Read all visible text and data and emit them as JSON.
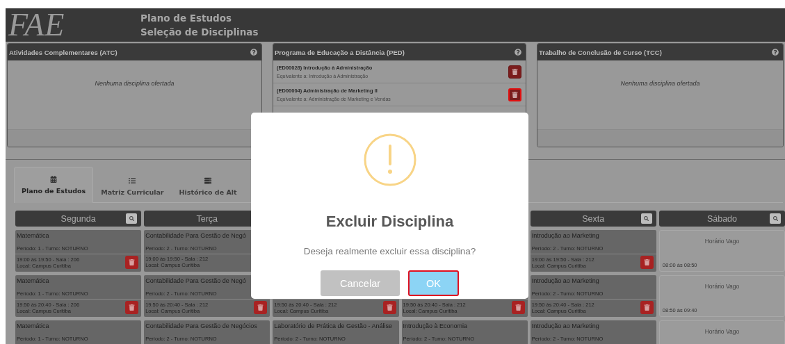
{
  "header": {
    "logo": "FAE",
    "title": "Plano de Estudos",
    "subtitle": "Seleção de Disciplinas"
  },
  "panels": [
    {
      "title": "Atividades Complementares (ATC)",
      "empty_text": "Nenhuma disciplina ofertada"
    },
    {
      "title": "Programa de Educação a Distância (PED)",
      "items": [
        {
          "title": "(ED00028) Introdução à Administração",
          "equivalent": "Equivalente a: Introdução à Administração",
          "focused": false
        },
        {
          "title": "(ED00004) Administração de Marketing II",
          "equivalent": "Equivalente a: Administração de Marketing e Vendas",
          "focused": true
        }
      ]
    },
    {
      "title": "Trabalho de Conclusão de Curso (TCC)",
      "empty_text": "Nenhuma disciplina ofertada"
    }
  ],
  "tabs": [
    {
      "label": "Plano de Estudos",
      "selected": true
    },
    {
      "label": "Matriz Curricular",
      "selected": false
    },
    {
      "label": "Histórico de Alt",
      "selected": false
    }
  ],
  "schedule": [
    {
      "day": "Segunda",
      "cells": [
        {
          "kind": "class",
          "title": "Matemática",
          "period": "Período: 1 - Turno: NOTURNO",
          "time": "19:00 às 19:50 - Sala : 206",
          "place": "Local: Campus Curitiba",
          "delete_button": true
        },
        {
          "kind": "class",
          "title": "Matemática",
          "period": "Período: 1 - Turno: NOTURNO",
          "time": "19:50 às 20:40 - Sala : 206",
          "place": "Local: Campus Curitiba",
          "delete_button": true
        },
        {
          "kind": "class",
          "title": "Matemática",
          "period": "Período: 1 - Turno: NOTURNO"
        }
      ]
    },
    {
      "day": "Terça",
      "cells": [
        {
          "kind": "class",
          "title": "Contabilidade Para Gestão de Negó",
          "period": "Período: 2 - Turno: NOTURNO",
          "time": "19:00 às 19:50 - Sala : 212",
          "place": "Local: Campus Curitiba",
          "delete_button": false
        },
        {
          "kind": "class",
          "title": "Contabilidade Para Gestão de Negó",
          "period": "Período: 2 - Turno: NOTURNO",
          "time": "19:50 às 20:40 - Sala : 212",
          "place": "Local: Campus Curitiba",
          "delete_button": true
        },
        {
          "kind": "class",
          "title": "Contabilidade Para Gestão de Negócios",
          "period": "Período: 2 - Turno: NOTURNO"
        }
      ]
    },
    {
      "cells": [
        {
          "kind": "covered"
        },
        {
          "kind": "class",
          "time": "19:50 às 20:40 - Sala : 212",
          "place": "Local: Campus Curitiba",
          "delete_button": true
        },
        {
          "kind": "class",
          "title": "Laboratório de Prática de Gestão - Análise",
          "period": "Período: 2 - Turno: NOTURNO"
        }
      ]
    },
    {
      "cells": [
        {
          "kind": "covered"
        },
        {
          "kind": "class",
          "time": "19:50 às 20:40 - Sala : 212",
          "place": "Local: Campus Curitiba",
          "delete_button": true
        },
        {
          "kind": "class",
          "title": "Introdução à Economia",
          "period": "Período: 2 - Turno: NOTURNO"
        }
      ]
    },
    {
      "day": "Sexta",
      "cells": [
        {
          "kind": "class",
          "title": "Introdução ao Marketing",
          "period": "Período: 2 - Turno: NOTURNO",
          "time": "19:00 às 19:50 - Sala : 212",
          "place": "Local: Campus Curitiba",
          "delete_button": true
        },
        {
          "kind": "class",
          "title": "Introdução ao Marketing",
          "period": "Período: 2 - Turno: NOTURNO",
          "time": "19:50 às 20:40 - Sala : 212",
          "place": "Local: Campus Curitiba",
          "delete_button": true
        },
        {
          "kind": "class",
          "title": "Introdução ao Marketing",
          "period": "Período: 2 - Turno: NOTURNO"
        }
      ]
    },
    {
      "day": "Sábado",
      "cells": [
        {
          "kind": "free",
          "label": "Horário Vago",
          "time": "08:00 às 08:50"
        },
        {
          "kind": "free",
          "label": "Horário Vago",
          "time": "08:50 às 09:40"
        },
        {
          "kind": "free",
          "label": "Horário Vago"
        }
      ]
    }
  ],
  "dialog": {
    "title": "Excluir Disciplina",
    "message": "Deseja realmente excluir essa disciplina?",
    "buttons": [
      {
        "label": "Cancelar",
        "kind": "cancel",
        "focused": false
      },
      {
        "label": "OK",
        "kind": "confirm",
        "focused": true
      }
    ]
  }
}
